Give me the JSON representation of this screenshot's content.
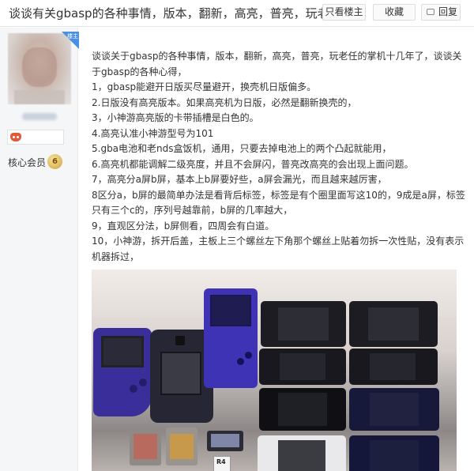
{
  "header": {
    "title": "谈谈有关gbasp的各种事情，版本，翻新，高亮，普亮，玩老任",
    "only_op_label": "只看楼主",
    "favorite_label": "收藏",
    "reply_label": "回复"
  },
  "sidebar": {
    "corner_tag": "楼主",
    "member_label": "核心会员",
    "member_level": "6"
  },
  "post": {
    "paragraphs": [
      "谈谈关于gbasp的各种事情，版本，翻新，高亮，普亮，玩老任的掌机十几年了，谈谈关于gbasp的各种心得，",
      "1，gbasp能避开日版买尽量避开，换壳机日版偏多。",
      "2.日版没有高亮版本。如果高亮机为日版，必然是翻新换壳的，",
      "3，小神游高亮版的卡带插槽是白色的。",
      "4.高亮认准小神游型号为101",
      "5.gba电池和老nds盒饭机，通用，只要去掉电池上的两个凸起就能用，",
      "6.高亮机都能调解二级亮度，并且不会屏闪，普亮改高亮的会出现上面问题。",
      "7，高亮分a屏b屏，基本上b屏要好些，a屏会漏光，而且越来越厉害，",
      "8区分a，b屏的最简单办法是看背后标签，标签是有个圈里面写这10的，9成是a屏，标签只有三个c的，序列号越靠前，b屏的几率越大，",
      "9，直观区分法，b屏侧看，四周会有白道。",
      "10，小神游，拆开后盖，主板上三个螺丝左下角那个螺丝上贴着勿拆一次性贴，没有表示机器拆过，"
    ]
  },
  "photo": {
    "r4_label": "R4"
  }
}
